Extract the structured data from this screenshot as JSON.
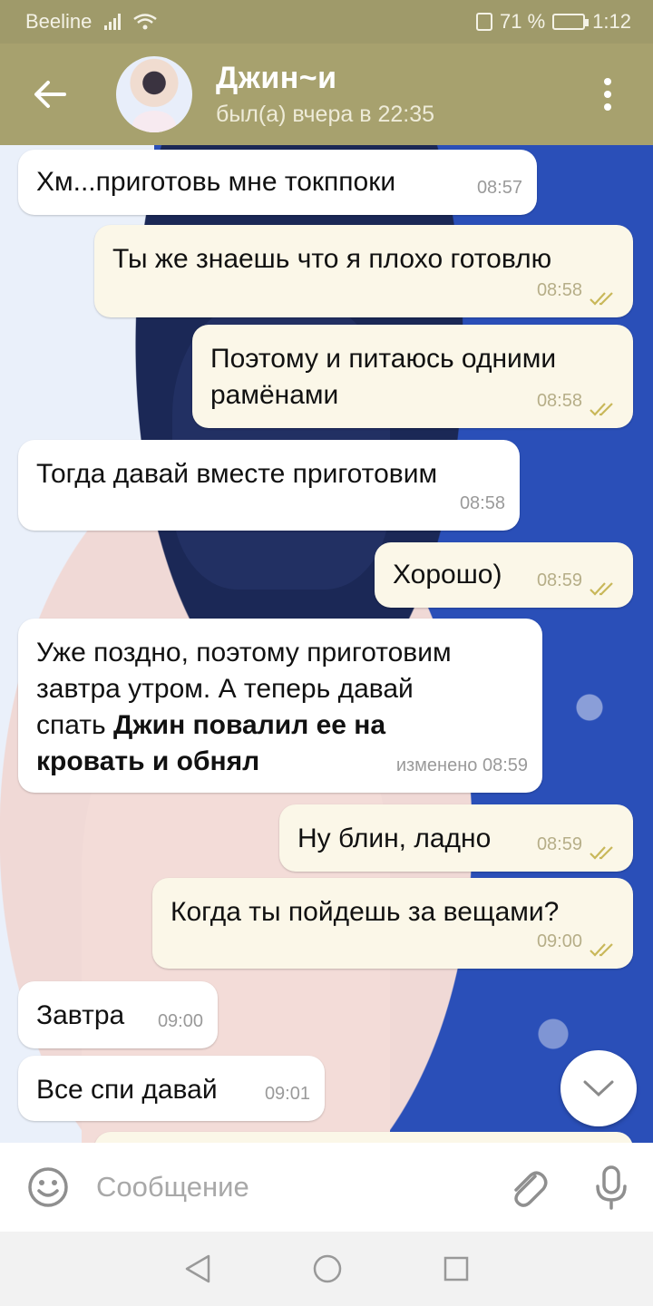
{
  "statusbar": {
    "carrier": "Beeline",
    "battery": "71 %",
    "battery_level": 0.71,
    "time": "1:12"
  },
  "header": {
    "title": "Джин~и",
    "status": "был(а) вчера в 22:35",
    "icons": [
      "back-arrow-icon",
      "avatar",
      "more-vert-icon"
    ]
  },
  "messages": [
    {
      "dir": "in",
      "text": "Хм...приготовь мне токппоки",
      "time": "08:57"
    },
    {
      "dir": "out",
      "text": "Ты же знаешь что я плохо готовлю",
      "time": "08:58",
      "read": true
    },
    {
      "dir": "out",
      "line1": "Поэтому и питаюсь одними",
      "line2": "рамёнами",
      "time": "08:58",
      "read": true
    },
    {
      "dir": "in",
      "text": "Тогда давай вместе приготовим",
      "time": "08:58"
    },
    {
      "dir": "out",
      "text": "Хорошо)",
      "time": "08:59",
      "read": true
    },
    {
      "dir": "in",
      "line1": "Уже поздно, поэтому приготовим",
      "line2": "завтра утром. А теперь давай",
      "line3": "спать ",
      "bold1": "Джин повалил ее на",
      "bold2": "кровать и обнял",
      "time": "изменено 08:59"
    },
    {
      "dir": "out",
      "text": "Ну блин, ладно",
      "time": "08:59",
      "read": true
    },
    {
      "dir": "out",
      "text": "Когда ты пойдешь за вещами?",
      "time": "09:00",
      "read": true
    },
    {
      "dir": "in",
      "text": "Завтра",
      "time": "09:00"
    },
    {
      "dir": "in",
      "text": "Все спи давай",
      "time": "09:01"
    }
  ],
  "input": {
    "placeholder": "Сообщение"
  },
  "colors": {
    "header": "#a7a16e",
    "statusbar": "#9f9a6a",
    "incoming": "#ffffff",
    "outgoing": "#fbf7e8",
    "read_ticks": "#c9b85a"
  }
}
